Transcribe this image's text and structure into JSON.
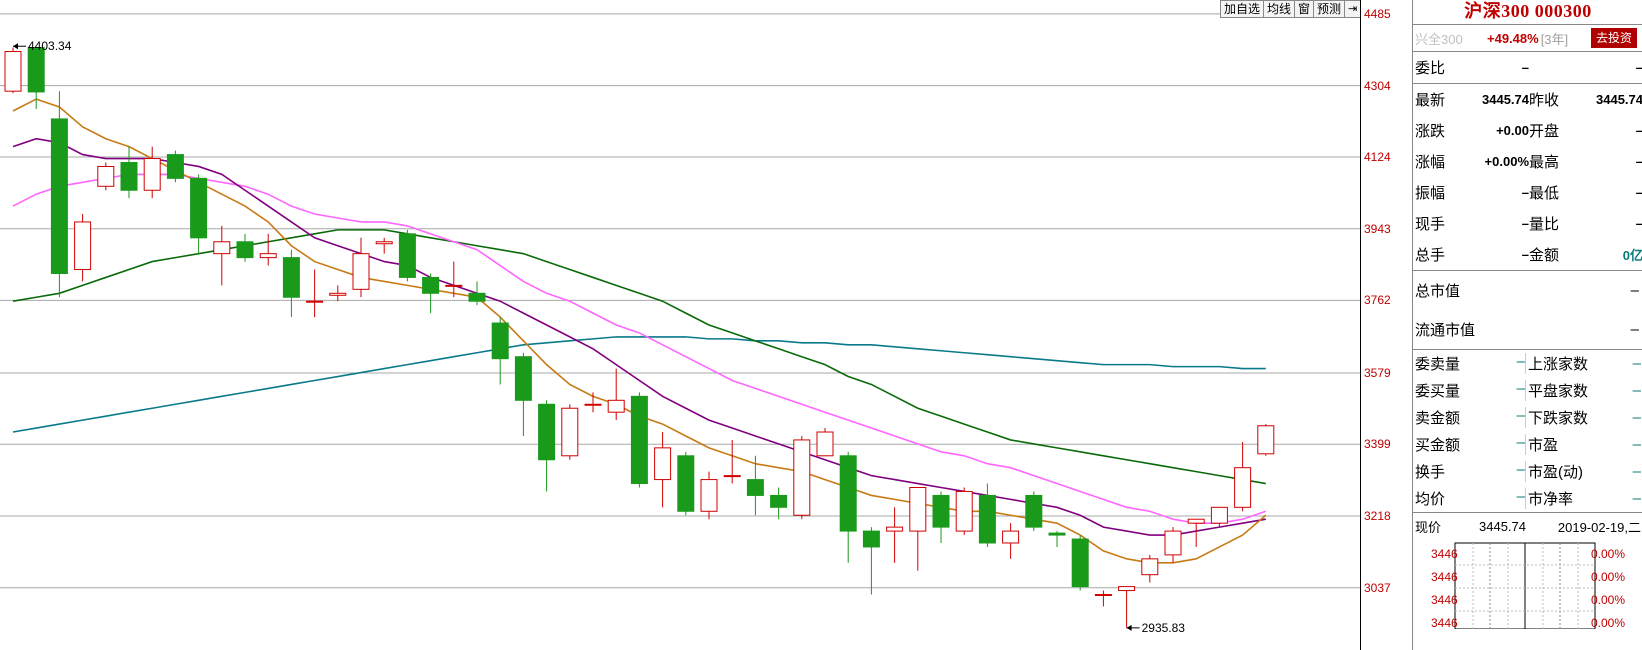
{
  "toolbar": {
    "buttons": [
      "加自选",
      "均线",
      "窗",
      "预测"
    ],
    "arrow": "⇥"
  },
  "chart": {
    "y_labels": [
      "4485",
      "4304",
      "4124",
      "3943",
      "3762",
      "3579",
      "3399",
      "3218",
      "3037"
    ],
    "high_annotation": "4403.34",
    "low_annotation": "2935.83",
    "colors": {
      "up": "#d00000",
      "down": "#1a9a1a",
      "ma1": "#c87a14",
      "ma2": "#800080",
      "ma3": "#ff66ff",
      "ma4": "#0a6a0a",
      "ma5": "#0a7a8a",
      "grid": "#a8a8a8"
    }
  },
  "chart_data": {
    "type": "candlestick",
    "ylim": [
      2880,
      4520
    ],
    "candles": [
      {
        "o": 4290,
        "c": 4390,
        "h": 4400,
        "l": 4285
      },
      {
        "o": 4400,
        "c": 4288,
        "h": 4400,
        "l": 4245
      },
      {
        "o": 4220,
        "c": 3830,
        "h": 4290,
        "l": 3770
      },
      {
        "o": 3840,
        "c": 3960,
        "h": 3980,
        "l": 3810
      },
      {
        "o": 4050,
        "c": 4100,
        "h": 4110,
        "l": 4040
      },
      {
        "o": 4110,
        "c": 4040,
        "h": 4150,
        "l": 4020
      },
      {
        "o": 4040,
        "c": 4120,
        "h": 4150,
        "l": 4020
      },
      {
        "o": 4130,
        "c": 4070,
        "h": 4140,
        "l": 4060
      },
      {
        "o": 4070,
        "c": 3920,
        "h": 4080,
        "l": 3880
      },
      {
        "o": 3880,
        "c": 3910,
        "h": 3950,
        "l": 3800
      },
      {
        "o": 3910,
        "c": 3870,
        "h": 3930,
        "l": 3860
      },
      {
        "o": 3870,
        "c": 3880,
        "h": 3930,
        "l": 3850
      },
      {
        "o": 3870,
        "c": 3770,
        "h": 3890,
        "l": 3720
      },
      {
        "o": 3760,
        "c": 3760,
        "h": 3840,
        "l": 3720
      },
      {
        "o": 3775,
        "c": 3780,
        "h": 3800,
        "l": 3760
      },
      {
        "o": 3790,
        "c": 3880,
        "h": 3920,
        "l": 3770
      },
      {
        "o": 3905,
        "c": 3910,
        "h": 3920,
        "l": 3880
      },
      {
        "o": 3930,
        "c": 3820,
        "h": 3940,
        "l": 3810
      },
      {
        "o": 3820,
        "c": 3780,
        "h": 3830,
        "l": 3730
      },
      {
        "o": 3800,
        "c": 3800,
        "h": 3860,
        "l": 3770
      },
      {
        "o": 3780,
        "c": 3760,
        "h": 3810,
        "l": 3750
      },
      {
        "o": 3705,
        "c": 3615,
        "h": 3720,
        "l": 3550
      },
      {
        "o": 3620,
        "c": 3510,
        "h": 3630,
        "l": 3420
      },
      {
        "o": 3500,
        "c": 3360,
        "h": 3510,
        "l": 3280
      },
      {
        "o": 3370,
        "c": 3490,
        "h": 3500,
        "l": 3360
      },
      {
        "o": 3500,
        "c": 3500,
        "h": 3530,
        "l": 3480
      },
      {
        "o": 3480,
        "c": 3510,
        "h": 3590,
        "l": 3460
      },
      {
        "o": 3520,
        "c": 3300,
        "h": 3530,
        "l": 3290
      },
      {
        "o": 3310,
        "c": 3390,
        "h": 3430,
        "l": 3240
      },
      {
        "o": 3370,
        "c": 3230,
        "h": 3380,
        "l": 3220
      },
      {
        "o": 3230,
        "c": 3310,
        "h": 3330,
        "l": 3210
      },
      {
        "o": 3320,
        "c": 3320,
        "h": 3410,
        "l": 3300
      },
      {
        "o": 3310,
        "c": 3270,
        "h": 3370,
        "l": 3220
      },
      {
        "o": 3270,
        "c": 3240,
        "h": 3290,
        "l": 3210
      },
      {
        "o": 3220,
        "c": 3410,
        "h": 3420,
        "l": 3210
      },
      {
        "o": 3370,
        "c": 3430,
        "h": 3440,
        "l": 3370
      },
      {
        "o": 3370,
        "c": 3180,
        "h": 3380,
        "l": 3100
      },
      {
        "o": 3180,
        "c": 3140,
        "h": 3190,
        "l": 3020
      },
      {
        "o": 3180,
        "c": 3190,
        "h": 3240,
        "l": 3100
      },
      {
        "o": 3180,
        "c": 3290,
        "h": 3290,
        "l": 3080
      },
      {
        "o": 3270,
        "c": 3190,
        "h": 3280,
        "l": 3150
      },
      {
        "o": 3180,
        "c": 3280,
        "h": 3290,
        "l": 3170
      },
      {
        "o": 3270,
        "c": 3150,
        "h": 3300,
        "l": 3140
      },
      {
        "o": 3150,
        "c": 3180,
        "h": 3200,
        "l": 3110
      },
      {
        "o": 3270,
        "c": 3190,
        "h": 3280,
        "l": 3180
      },
      {
        "o": 3175,
        "c": 3170,
        "h": 3180,
        "l": 3140
      },
      {
        "o": 3160,
        "c": 3040,
        "h": 3170,
        "l": 3030
      },
      {
        "o": 3020,
        "c": 3020,
        "h": 3030,
        "l": 2990
      },
      {
        "o": 3030,
        "c": 3040,
        "h": 3040,
        "l": 2936
      },
      {
        "o": 3070,
        "c": 3110,
        "h": 3120,
        "l": 3050
      },
      {
        "o": 3120,
        "c": 3180,
        "h": 3190,
        "l": 3100
      },
      {
        "o": 3200,
        "c": 3210,
        "h": 3210,
        "l": 3140
      },
      {
        "o": 3200,
        "c": 3240,
        "h": 3240,
        "l": 3190
      },
      {
        "o": 3240,
        "c": 3340,
        "h": 3405,
        "l": 3230
      },
      {
        "o": 3375,
        "c": 3445.74,
        "h": 3450,
        "l": 3370
      }
    ],
    "ma_short": [
      4240,
      4270,
      4250,
      4200,
      4170,
      4150,
      4120,
      4090,
      4060,
      4030,
      4000,
      3960,
      3900,
      3860,
      3840,
      3820,
      3810,
      3800,
      3790,
      3780,
      3770,
      3720,
      3660,
      3600,
      3550,
      3520,
      3500,
      3470,
      3450,
      3420,
      3390,
      3370,
      3350,
      3340,
      3330,
      3310,
      3290,
      3270,
      3260,
      3250,
      3240,
      3230,
      3230,
      3220,
      3210,
      3200,
      3170,
      3130,
      3110,
      3100,
      3100,
      3110,
      3140,
      3170,
      3220
    ],
    "ma_mid": [
      4150,
      4170,
      4160,
      4130,
      4120,
      4120,
      4120,
      4110,
      4100,
      4080,
      4040,
      4000,
      3960,
      3920,
      3900,
      3880,
      3860,
      3850,
      3820,
      3800,
      3780,
      3760,
      3730,
      3700,
      3670,
      3640,
      3600,
      3560,
      3520,
      3490,
      3460,
      3440,
      3420,
      3400,
      3380,
      3360,
      3340,
      3320,
      3310,
      3300,
      3290,
      3280,
      3270,
      3260,
      3250,
      3240,
      3220,
      3190,
      3180,
      3170,
      3170,
      3180,
      3190,
      3200,
      3210
    ],
    "ma_long": [
      4000,
      4030,
      4050,
      4060,
      4070,
      4080,
      4080,
      4080,
      4070,
      4060,
      4050,
      4030,
      4000,
      3980,
      3970,
      3960,
      3960,
      3950,
      3930,
      3910,
      3890,
      3850,
      3810,
      3780,
      3760,
      3730,
      3700,
      3680,
      3650,
      3620,
      3590,
      3560,
      3540,
      3520,
      3500,
      3480,
      3460,
      3440,
      3420,
      3400,
      3380,
      3370,
      3350,
      3340,
      3320,
      3300,
      3280,
      3260,
      3240,
      3230,
      3210,
      3200,
      3200,
      3210,
      3230
    ],
    "ma_longer": [
      3760,
      3770,
      3780,
      3800,
      3820,
      3840,
      3860,
      3870,
      3880,
      3890,
      3900,
      3910,
      3920,
      3930,
      3940,
      3940,
      3940,
      3930,
      3920,
      3910,
      3900,
      3890,
      3880,
      3860,
      3840,
      3820,
      3800,
      3780,
      3760,
      3730,
      3700,
      3680,
      3660,
      3640,
      3620,
      3600,
      3570,
      3550,
      3520,
      3490,
      3470,
      3450,
      3430,
      3410,
      3400,
      3390,
      3380,
      3370,
      3360,
      3350,
      3340,
      3330,
      3320,
      3310,
      3300
    ],
    "ma_longest": [
      3430,
      3440,
      3450,
      3460,
      3470,
      3480,
      3490,
      3500,
      3510,
      3520,
      3530,
      3540,
      3550,
      3560,
      3570,
      3580,
      3590,
      3600,
      3610,
      3620,
      3630,
      3640,
      3650,
      3655,
      3660,
      3665,
      3670,
      3670,
      3670,
      3670,
      3665,
      3665,
      3660,
      3660,
      3655,
      3655,
      3650,
      3650,
      3645,
      3640,
      3635,
      3630,
      3625,
      3620,
      3615,
      3610,
      3605,
      3600,
      3600,
      3600,
      3595,
      3595,
      3595,
      3590,
      3590
    ]
  },
  "panel": {
    "title": "沪深300 000300",
    "return_index": "兴全300",
    "return_pct": "+49.48%",
    "return_years": "[3年]",
    "invest_button": "去投资",
    "weibi_label": "委比",
    "weibi_value": "–",
    "weibi_right": "–",
    "rows": [
      {
        "lab": "最新",
        "val": "3445.74",
        "lab2": "昨收",
        "val2": "3445.74"
      },
      {
        "lab": "涨跌",
        "val": "+0.00",
        "lab2": "开盘",
        "val2": "–"
      },
      {
        "lab": "涨幅",
        "val": "+0.00%",
        "lab2": "最高",
        "val2": "–"
      },
      {
        "lab": "振幅",
        "val": "–",
        "lab2": "最低",
        "val2": "–"
      },
      {
        "lab": "现手",
        "val": "–",
        "lab2": "量比",
        "val2": "–"
      },
      {
        "lab": "总手",
        "val": "–",
        "lab2": "金额",
        "val2": "0亿"
      }
    ],
    "market_cap_label": "总市值",
    "market_cap_value": "–",
    "float_cap_label": "流通市值",
    "float_cap_value": "–",
    "stats": [
      {
        "lab": "委卖量",
        "lab2": "上涨家数"
      },
      {
        "lab": "委买量",
        "lab2": "平盘家数"
      },
      {
        "lab": "卖金额",
        "lab2": "下跌家数"
      },
      {
        "lab": "买金额",
        "lab2": "市盈"
      },
      {
        "lab": "换手",
        "lab2": "市盈(动)"
      },
      {
        "lab": "均价",
        "lab2": "市净率"
      }
    ],
    "dash": "–",
    "now_label": "现价",
    "now_price": "3445.74",
    "now_date": "2019-02-19,二",
    "mini_left": [
      "3446",
      "3446",
      "3446",
      "3446"
    ],
    "mini_right": [
      "0.00%",
      "0.00%",
      "0.00%",
      "0.00%"
    ]
  }
}
